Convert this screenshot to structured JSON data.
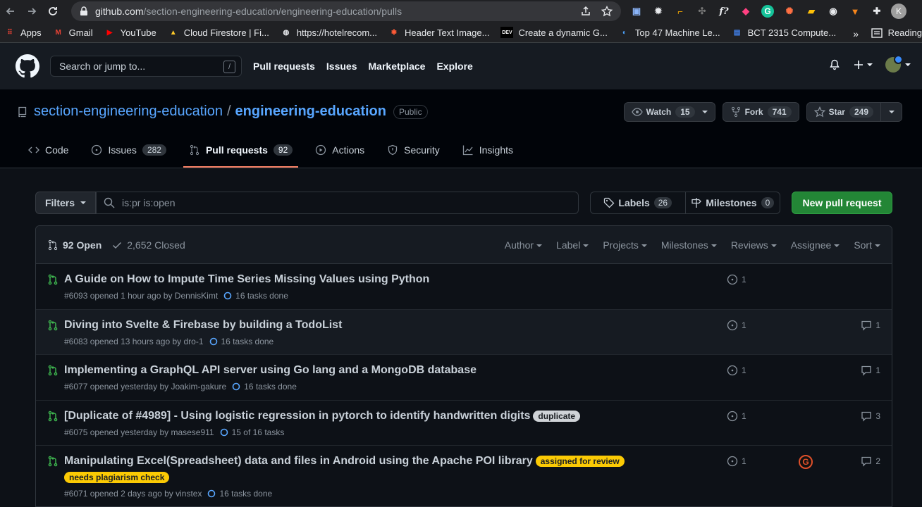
{
  "browser": {
    "url_host": "github.com",
    "url_path": "/section-engineering-education/engineering-education/pulls",
    "profile_initial": "K",
    "bookmarks": [
      {
        "label": "Apps",
        "icon": "apps-grid-icon",
        "color": "#ea4335"
      },
      {
        "label": "Gmail",
        "icon": "gmail-icon",
        "color": "#ea4335"
      },
      {
        "label": "YouTube",
        "icon": "youtube-icon",
        "color": "#ff0000"
      },
      {
        "label": "Cloud Firestore | Fi...",
        "icon": "firebase-icon",
        "color": "#ffca28"
      },
      {
        "label": "https://hotelrecom...",
        "icon": "globe-icon",
        "color": "#e8eaed"
      },
      {
        "label": "Header Text Image...",
        "icon": "asterisk-icon",
        "color": "#ff5a36"
      },
      {
        "label": "Create a dynamic G...",
        "icon": "dev-icon",
        "color": "#ffffff"
      },
      {
        "label": "Top 47 Machine Le...",
        "icon": "ml-icon",
        "color": "#4da3ff"
      },
      {
        "label": "BCT 2315 Compute...",
        "icon": "docs-icon",
        "color": "#4285f4"
      }
    ],
    "bookmarks_more": "»",
    "reading_list": "Reading"
  },
  "github": {
    "search_placeholder": "Search or jump to...",
    "search_key": "/",
    "nav": [
      "Pull requests",
      "Issues",
      "Marketplace",
      "Explore"
    ]
  },
  "repo": {
    "owner": "section-engineering-education",
    "separator": "/",
    "name": "engineering-education",
    "visibility": "Public",
    "watch_label": "Watch",
    "watch_count": "15",
    "fork_label": "Fork",
    "fork_count": "741",
    "star_label": "Star",
    "star_count": "249",
    "tabs": [
      {
        "label": "Code",
        "count": null,
        "icon": "code-icon"
      },
      {
        "label": "Issues",
        "count": "282",
        "icon": "issue-opened-icon"
      },
      {
        "label": "Pull requests",
        "count": "92",
        "icon": "git-pull-request-icon"
      },
      {
        "label": "Actions",
        "count": null,
        "icon": "play-icon"
      },
      {
        "label": "Security",
        "count": null,
        "icon": "shield-icon"
      },
      {
        "label": "Insights",
        "count": null,
        "icon": "graph-icon"
      }
    ]
  },
  "filter_bar": {
    "filters_label": "Filters",
    "query": "is:pr is:open",
    "labels_label": "Labels",
    "labels_count": "26",
    "milestones_label": "Milestones",
    "milestones_count": "0",
    "new_pr_label": "New pull request"
  },
  "list": {
    "open_label": "92 Open",
    "closed_label": "2,652 Closed",
    "sort_menus": [
      "Author",
      "Label",
      "Projects",
      "Milestones",
      "Reviews",
      "Assignee",
      "Sort"
    ],
    "rows": [
      {
        "title": "A Guide on How to Impute Time Series Missing Values using Python",
        "meta": "#6093 opened 1 hour ago by DennisKimt",
        "tasks": "16 tasks done",
        "issues": "1",
        "comments": null,
        "labels": [],
        "assignee": false
      },
      {
        "title": "Diving into Svelte & Firebase by building a TodoList",
        "meta": "#6083 opened 13 hours ago by dro-1",
        "tasks": "16 tasks done",
        "issues": "1",
        "comments": "1",
        "labels": [],
        "assignee": false
      },
      {
        "title": "Implementing a GraphQL API server using Go lang and a MongoDB database",
        "meta": "#6077 opened yesterday by Joakim-gakure",
        "tasks": "16 tasks done",
        "issues": "1",
        "comments": "1",
        "labels": [],
        "assignee": false
      },
      {
        "title": "[Duplicate of #4989] - Using logistic regression in pytorch to identify handwritten digits",
        "meta": "#6075 opened yesterday by masese911",
        "tasks": "15 of 16 tasks",
        "issues": "1",
        "comments": "3",
        "labels": [
          {
            "text": "duplicate",
            "bg": "#cfd3d7",
            "fg": "#1b1f23"
          }
        ],
        "assignee": false
      },
      {
        "title": "Manipulating Excel(Spreadsheet) data and files in Android using the Apache POI library",
        "meta": "#6071 opened 2 days ago by vinstex",
        "tasks": "16 tasks done",
        "issues": "1",
        "comments": "2",
        "labels": [
          {
            "text": "assigned for review",
            "bg": "#fbca04",
            "fg": "#1b1f23"
          },
          {
            "text": "needs plagiarism check",
            "bg": "#fbca04",
            "fg": "#1b1f23"
          }
        ],
        "assignee": true,
        "assignee_initial": "G"
      }
    ]
  },
  "colors": {
    "accent_tab": "#f78166",
    "open_pr": "#3fb950",
    "primary_button": "#238636",
    "link": "#58a6ff"
  }
}
